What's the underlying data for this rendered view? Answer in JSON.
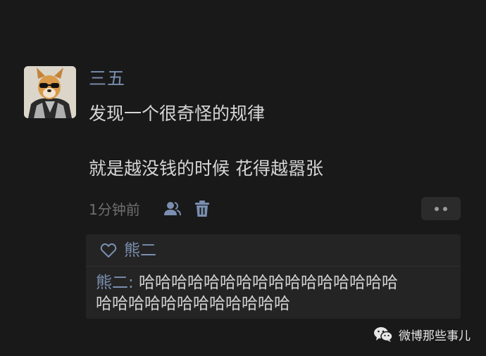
{
  "post": {
    "username": "三五",
    "text_line1": "发现一个很奇怪的规律",
    "text_line2": "就是越没钱的时候 花得越嚣张",
    "time": "1分钟前",
    "icons": {
      "privacy": "person-icon",
      "delete": "trash-icon",
      "more": "more-dots-icon"
    }
  },
  "comments": {
    "likes_name": "熊二",
    "items": [
      {
        "author": "熊二:",
        "line1_rest": " 哈哈哈哈哈哈哈哈哈哈哈哈哈哈哈哈",
        "line2": "哈哈哈哈哈哈哈哈哈哈哈哈"
      }
    ]
  },
  "watermark": {
    "text": "微博那些事儿",
    "icon": "wechat-icon"
  },
  "colors": {
    "background": "#191919",
    "name_link": "#7a8fb0",
    "text": "#d6d6d6",
    "muted": "#6f6f6f",
    "comment_bg": "#242424"
  }
}
